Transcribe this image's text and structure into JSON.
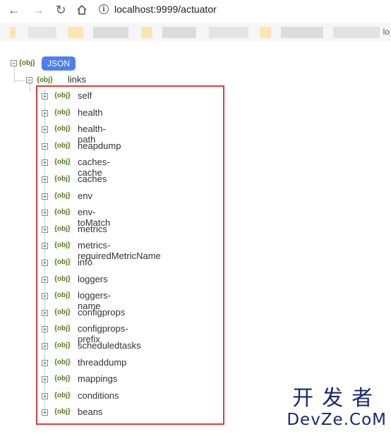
{
  "browser": {
    "url": "localhost:9999/actuator",
    "bookmark_trailing_text": "lo"
  },
  "tree": {
    "root_tag": "{obj}",
    "root_badge": "JSON",
    "links_tag": "{obj}",
    "links_key": "links",
    "child_tag": "{obj}",
    "items": [
      "self",
      "health",
      "health-path",
      "heapdump",
      "caches-cache",
      "caches",
      "env",
      "env-toMatch",
      "metrics",
      "metrics-requiredMetricName",
      "info",
      "loggers",
      "loggers-name",
      "configprops",
      "configprops-prefix",
      "scheduledtasks",
      "threaddump",
      "mappings",
      "conditions",
      "beans"
    ]
  },
  "watermark": {
    "chinese": "开发者",
    "latin": "DevZe.CoM"
  },
  "colors": {
    "badge": "#4f7ef0",
    "highlight_box": "#e03c3c",
    "tag_text": "#4e7e1e"
  }
}
